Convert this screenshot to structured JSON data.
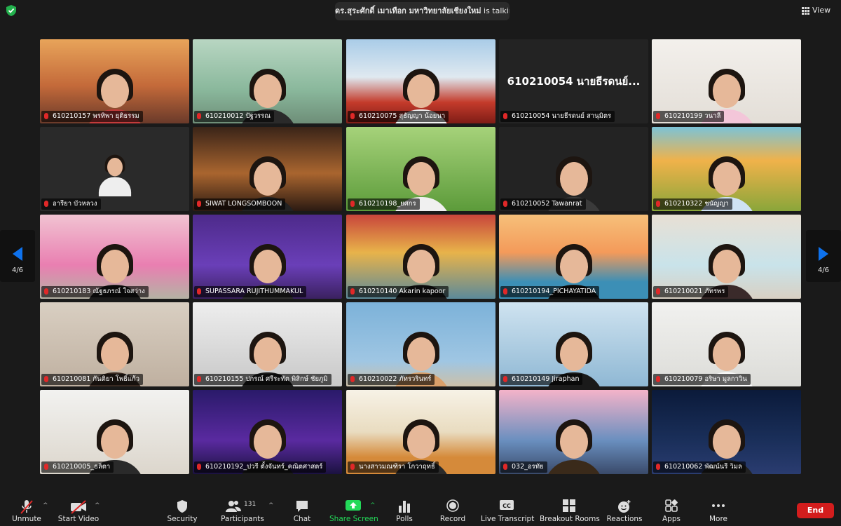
{
  "header": {
    "speaking_name": "ดร.สุระศักดิ์ เมาเทือก มหาวิทยาลัยเชียงใหม่",
    "speaking_suffix": " is talking ...",
    "view_label": "View"
  },
  "pager": {
    "left_label": "4/6",
    "right_label": "4/6"
  },
  "tiles": [
    {
      "name": "610210157 พรทิพา ยุติธรรม"
    },
    {
      "name": "610210012 ปัฐวรรณ"
    },
    {
      "name": "610210075 สุธัญญา น้อยนา"
    },
    {
      "name": "610210054 นายธีรดนย์ สานุมิตร",
      "big": "610210054 นายธีรดนย์..."
    },
    {
      "name": "610210199 วนาลี"
    },
    {
      "name": "อารียา บัวหลวง"
    },
    {
      "name": "SIWAT LONGSOMBOON"
    },
    {
      "name": "610210198_ยศกร"
    },
    {
      "name": "610210052 Tawanrat"
    },
    {
      "name": "610210322 ชนัญญา"
    },
    {
      "name": "610210183 ณัฐธภรณ์ ใจสว่าง"
    },
    {
      "name": "SUPASSARA RUJITHUMMAKUL"
    },
    {
      "name": "610210140 Akarin kapoor"
    },
    {
      "name": "610210194_PICHAYATIDA"
    },
    {
      "name": "610210021 ภัทรพร"
    },
    {
      "name": "610210081 กันติยา โพธิ์แก้ว"
    },
    {
      "name": "610210155 ปกรณ์ ศรีระทัต พิสิกษ์ ชัยภูมิ"
    },
    {
      "name": "610210022 ภัทรวรินทร์"
    },
    {
      "name": "610210149 Jiraphan"
    },
    {
      "name": "610210079 อริษา มูลกาวิน"
    },
    {
      "name": "610210005_ธลิตา"
    },
    {
      "name": "610210192_ปวรี ตั้งจันทร์_คณิตศาสตร์"
    },
    {
      "name": "นางสาวมณฑิรา โกวาฤทธิ์"
    },
    {
      "name": "032_อรทัย"
    },
    {
      "name": "610210062 พัฒน์นรี วิมล"
    }
  ],
  "toolbar": {
    "unmute": "Unmute",
    "start_video": "Start Video",
    "security": "Security",
    "participants": "Participants",
    "participants_count": "131",
    "chat": "Chat",
    "share_screen": "Share Screen",
    "polls": "Polls",
    "record": "Record",
    "live_transcript": "Live Transcript",
    "breakout_rooms": "Breakout Rooms",
    "reactions": "Reactions",
    "apps": "Apps",
    "more": "More",
    "end": "End"
  },
  "colors": {
    "accent_blue": "#0e72ed",
    "share_green": "#23d959",
    "end_red": "#d31d1d",
    "muted_red": "#e02828"
  }
}
